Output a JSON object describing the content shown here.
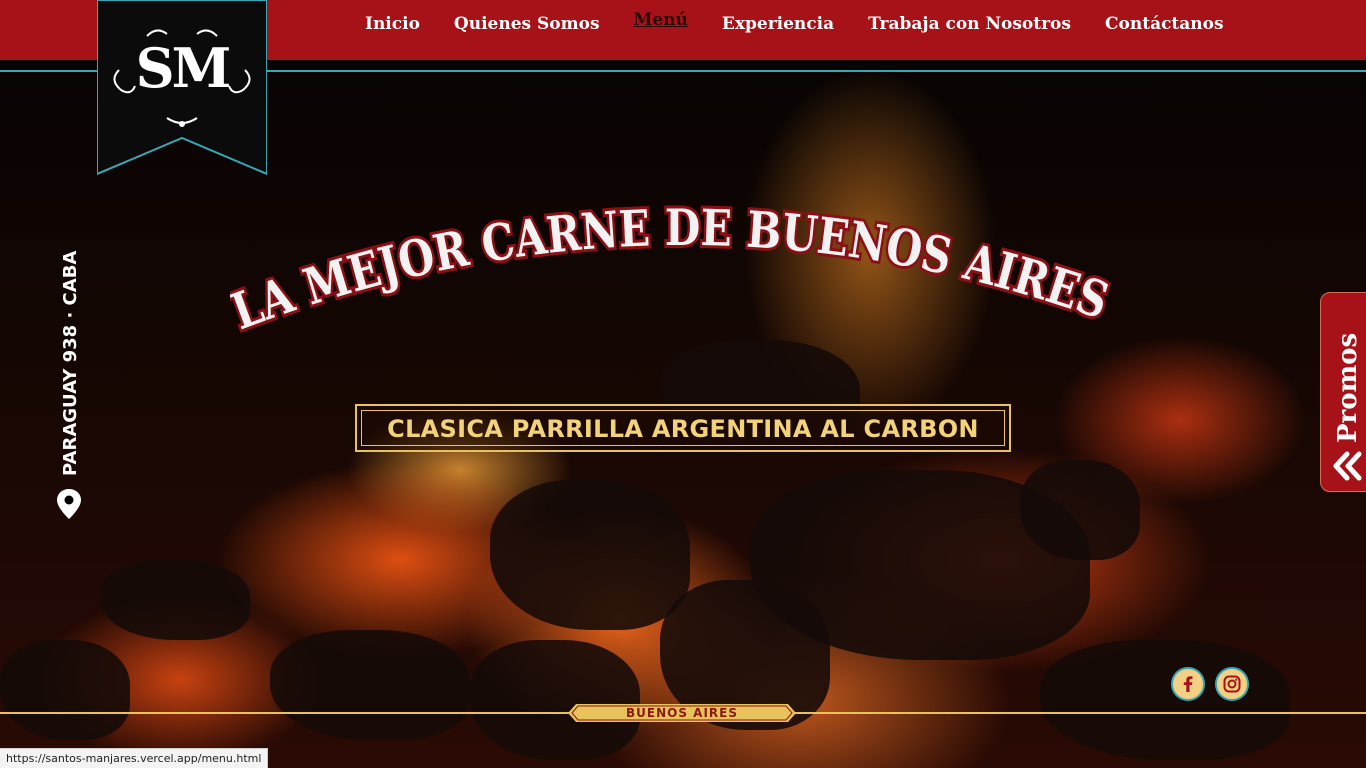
{
  "nav": {
    "items": [
      {
        "label": "Inicio"
      },
      {
        "label": "Quienes Somos"
      },
      {
        "label": "Menú"
      },
      {
        "label": "Experiencia"
      },
      {
        "label": "Trabaja con Nosotros"
      },
      {
        "label": "Contáctanos"
      }
    ],
    "active": "Menú"
  },
  "logo": {
    "text": "SM"
  },
  "address": {
    "text": "PARAGUAY 938 · CABA",
    "icon": "map-pin-icon"
  },
  "hero": {
    "headline": "LA MEJOR CARNE DE BUENOS AIRES",
    "tagline": "CLASICA PARRILLA ARGENTINA AL CARBON"
  },
  "promos": {
    "label": "Promos",
    "icon": "double-chevron-left-icon"
  },
  "social": {
    "facebook_icon": "facebook-icon",
    "instagram_icon": "instagram-icon"
  },
  "footer": {
    "badge": "BUENOS AIRES"
  },
  "status_bar": {
    "url": "https://santos-manjares.vercel.app/menu.html"
  },
  "colors": {
    "brand_red": "#a61218",
    "accent_teal": "#3aa6b4",
    "gold": "#e8c25a"
  }
}
